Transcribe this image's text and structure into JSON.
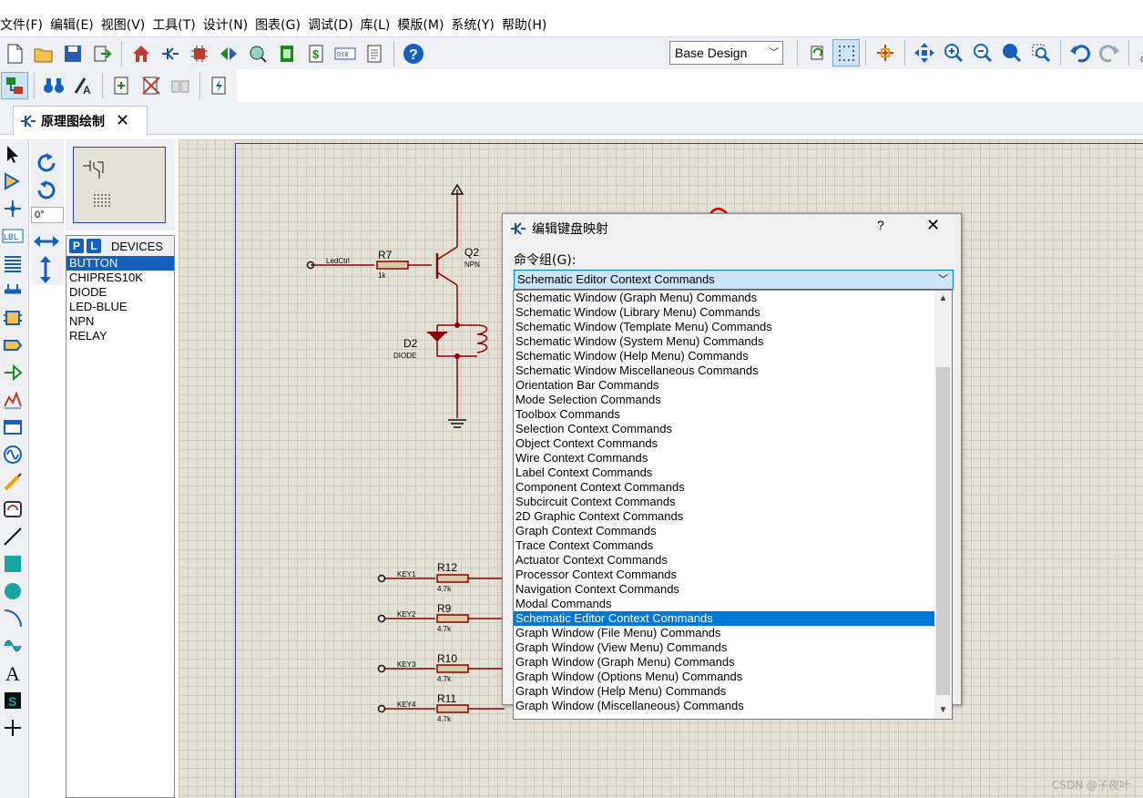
{
  "menubar": {
    "items": [
      "文件(F)",
      "编辑(E)",
      "视图(V)",
      "工具(T)",
      "设计(N)",
      "图表(G)",
      "调试(D)",
      "库(L)",
      "模版(M)",
      "系统(Y)",
      "帮助(H)"
    ]
  },
  "toolbar": {
    "design_select_value": "Base Design"
  },
  "document_tab": {
    "label": "原理图绘制",
    "close": "✕"
  },
  "rotation": {
    "angle": "0°"
  },
  "devices": {
    "p_label": "P",
    "l_label": "L",
    "header": "DEVICES",
    "items": [
      "BUTTON",
      "CHIPRES10K",
      "DIODE",
      "LED-BLUE",
      "NPN",
      "RELAY"
    ],
    "selected_index": 0
  },
  "schematic": {
    "r7": "R7",
    "r7_val": "1k",
    "q2": "Q2",
    "q2_type": "NPN",
    "ledctrl": "LedCtrl",
    "d2": "D2",
    "d2_type": "DIODE",
    "r12": "R12",
    "r9": "R9",
    "r10": "R10",
    "r11": "R11",
    "res_val": "4.7k",
    "key1": "KEY1",
    "key2": "KEY2",
    "key3": "KEY3",
    "key4": "KEY4"
  },
  "dialog": {
    "title": "编辑键盘映射",
    "help": "?",
    "close": "✕",
    "group_label": "命令组(G):",
    "combo_value": "Schematic Editor Context Commands",
    "list_items": [
      "Schematic Window (Graph Menu) Commands",
      "Schematic Window (Library Menu) Commands",
      "Schematic Window (Template Menu) Commands",
      "Schematic Window (System Menu) Commands",
      "Schematic Window (Help Menu) Commands",
      "Schematic Window Miscellaneous Commands",
      "Orientation Bar Commands",
      "Mode Selection Commands",
      "Toolbox Commands",
      "Selection Context Commands",
      "Object Context Commands",
      "Wire Context Commands",
      "Label Context Commands",
      "Component Context Commands",
      "Subcircuit Context Commands",
      "2D Graphic Context Commands",
      "Graph Context Commands",
      "Trace Context Commands",
      "Actuator Context Commands",
      "Processor Context Commands",
      "Navigation Context Commands",
      "Modal Commands",
      "Schematic Editor Context Commands",
      "Graph Window (File Menu) Commands",
      "Graph Window (View Menu) Commands",
      "Graph Window (Graph Menu) Commands",
      "Graph Window (Options Menu) Commands",
      "Graph Window (Help Menu) Commands",
      "Graph Window (Miscellaneous) Commands"
    ],
    "selected_index": 22
  },
  "watermark": "CSDN @子夜叶",
  "colors": {
    "accent": "#0078d7",
    "canvas": "#e4e2d6",
    "wire": "#8b0000",
    "annotation": "#d00000"
  }
}
